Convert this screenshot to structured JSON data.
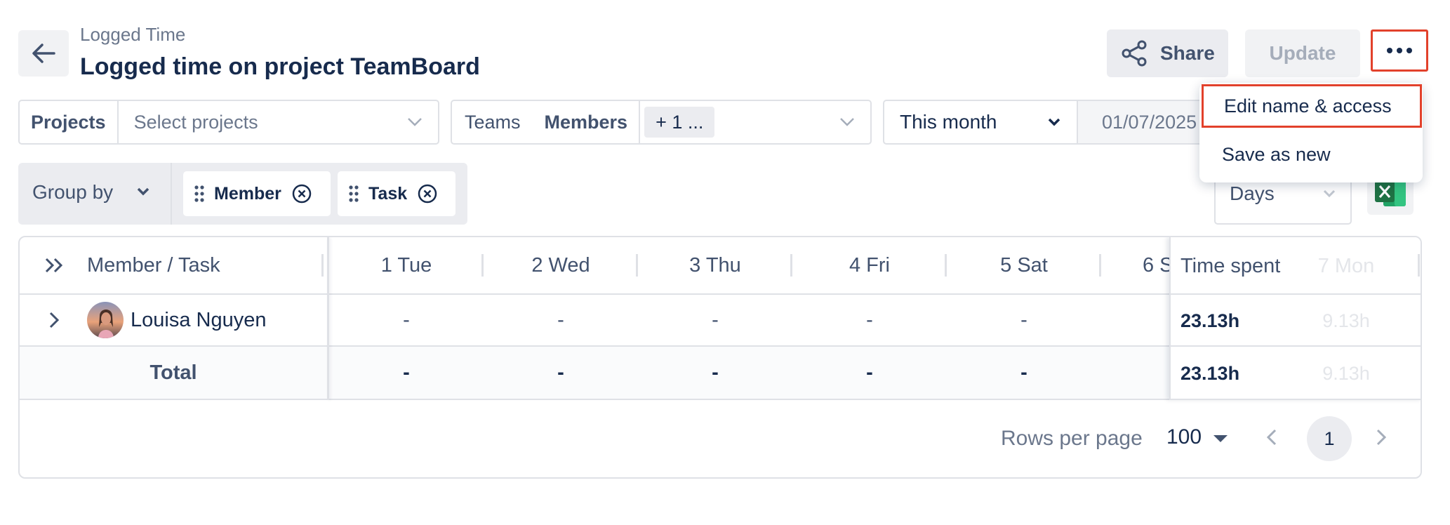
{
  "header": {
    "breadcrumb": "Logged Time",
    "title": "Logged time on project TeamBoard",
    "share_label": "Share",
    "update_label": "Update"
  },
  "menu": {
    "items": [
      {
        "label": "Edit name & access"
      },
      {
        "label": "Save as new"
      }
    ]
  },
  "filters": {
    "projects_label": "Projects",
    "projects_placeholder": "Select projects",
    "teams_label": "Teams",
    "members_label": "Members",
    "members_chip": "+ 1 ...",
    "period": "This month",
    "start_date": "01/07/2025"
  },
  "grouping": {
    "label": "Group by",
    "chips": [
      "Member",
      "Task"
    ],
    "unit": "Days"
  },
  "table": {
    "member_task_header": "Member / Task",
    "day_headers": [
      "1 Tue",
      "2 Wed",
      "3 Thu",
      "4 Fri",
      "5 Sat",
      "6 S"
    ],
    "time_spent_header": "Time spent",
    "ghost_header": "7 Mon",
    "rows": [
      {
        "name": "Louisa Nguyen",
        "days": [
          "-",
          "-",
          "-",
          "-",
          "-"
        ],
        "time_spent": "23.13h",
        "ghost": "9.13h"
      }
    ],
    "total": {
      "label": "Total",
      "days": [
        "-",
        "-",
        "-",
        "-",
        "-"
      ],
      "time_spent": "23.13h",
      "ghost": "9.13h"
    }
  },
  "pagination": {
    "rows_per_page_label": "Rows per page",
    "rows_per_page_value": "100",
    "current_page": "1"
  },
  "colors": {
    "highlight": "#e2412b",
    "excel_green": "#1f7244"
  }
}
